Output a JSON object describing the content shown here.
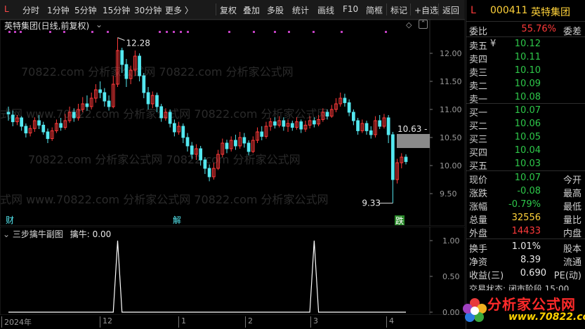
{
  "toolbar": {
    "items": [
      "分时",
      "1分钟",
      "5分钟",
      "15分钟",
      "30分钟",
      "更多 〉",
      "复权",
      "叠加",
      "多股",
      "统计",
      "画线",
      "F10",
      "简框",
      "标记",
      "+自选",
      "返回"
    ]
  },
  "main_chart": {
    "title": "英特集团(日线,前复权)",
    "high_label": "12.28",
    "low_label": "9.33",
    "current_label": "10.63",
    "y_ticks": [
      "12.00",
      "11.50",
      "11.00",
      "10.50",
      "10.00",
      "9.50"
    ],
    "marker_cai": "财",
    "marker_jie": "解",
    "marker_die": "跌",
    "watermarks": [
      "70822.com 分析家公式网",
      "式网 www.70822.com 分析家公式网"
    ]
  },
  "sub_chart": {
    "title": "三步擒牛副图",
    "indicator": "擒牛: 0.00",
    "y_ticks": [
      "1.00",
      "0.50",
      "0.00"
    ]
  },
  "xaxis": {
    "labels": [
      "2024年",
      "12",
      "1",
      "2",
      "3",
      "4"
    ]
  },
  "quote_panel": {
    "L": "L",
    "code": "000411",
    "name": "英特集团",
    "weibi_label": "委比",
    "weibi_value": "55.76%",
    "weicha_label": "委差",
    "asks": [
      {
        "label": "卖五",
        "flag": "¥",
        "price": "10.12"
      },
      {
        "label": "卖四",
        "flag": "",
        "price": "10.11"
      },
      {
        "label": "卖三",
        "flag": "",
        "price": "10.10"
      },
      {
        "label": "卖二",
        "flag": "",
        "price": "10.09"
      },
      {
        "label": "卖一",
        "flag": "",
        "price": "10.08"
      }
    ],
    "bids": [
      {
        "label": "买一",
        "price": "10.07"
      },
      {
        "label": "买二",
        "price": "10.06"
      },
      {
        "label": "买三",
        "price": "10.05"
      },
      {
        "label": "买四",
        "price": "10.04"
      },
      {
        "label": "买五",
        "price": "10.03"
      }
    ],
    "stats": [
      {
        "label": "现价",
        "value": "10.07",
        "color": "green",
        "r": "今开"
      },
      {
        "label": "涨跌",
        "value": "-0.08",
        "color": "green",
        "r": "最高"
      },
      {
        "label": "涨幅",
        "value": "-0.79%",
        "color": "green",
        "r": "最低"
      },
      {
        "label": "总量",
        "value": "32556",
        "color": "yellow",
        "r": "量比"
      },
      {
        "label": "外盘",
        "value": "14433",
        "color": "red",
        "r": "内盘"
      }
    ],
    "stats2": [
      {
        "label": "换手",
        "value": "1.01%",
        "r": "股本"
      },
      {
        "label": "净资",
        "value": "8.39",
        "r": "流通"
      },
      {
        "label": "收益(三)",
        "value": "0.690",
        "r": "PE(动)"
      }
    ],
    "trade_status": "交易状态: 闭市阶段 15:00",
    "logo_text": "分析家公式网",
    "logo_url": "www.70822.com"
  },
  "chart_data": {
    "type": "candlestick",
    "title": "英特集团(日线,前复权)",
    "ylim": [
      9.2,
      12.4
    ],
    "candles": [
      [
        10.95,
        10.92,
        11.05,
        10.8
      ],
      [
        10.9,
        10.78,
        10.98,
        10.7
      ],
      [
        10.78,
        10.85,
        10.9,
        10.72
      ],
      [
        10.85,
        10.7,
        10.88,
        10.62
      ],
      [
        10.7,
        10.58,
        10.75,
        10.5
      ],
      [
        10.58,
        10.66,
        10.72,
        10.52
      ],
      [
        10.66,
        10.8,
        10.86,
        10.6
      ],
      [
        10.8,
        10.72,
        10.9,
        10.65
      ],
      [
        10.72,
        10.6,
        10.78,
        10.55
      ],
      [
        10.6,
        10.48,
        10.66,
        10.4
      ],
      [
        10.48,
        10.62,
        10.68,
        10.44
      ],
      [
        10.62,
        10.75,
        10.82,
        10.58
      ],
      [
        10.75,
        10.68,
        10.85,
        10.62
      ],
      [
        10.68,
        10.8,
        10.92,
        10.64
      ],
      [
        10.8,
        10.95,
        11.05,
        10.76
      ],
      [
        10.95,
        10.85,
        11.02,
        10.78
      ],
      [
        10.85,
        11.0,
        11.1,
        10.8
      ],
      [
        11.0,
        11.1,
        11.22,
        10.95
      ],
      [
        11.1,
        11.05,
        11.25,
        10.98
      ],
      [
        11.05,
        11.2,
        11.3,
        11.0
      ],
      [
        11.2,
        11.35,
        11.45,
        11.12
      ],
      [
        11.35,
        11.3,
        11.5,
        11.2
      ],
      [
        11.3,
        11.15,
        11.38,
        11.05
      ],
      [
        11.15,
        11.05,
        11.25,
        10.98
      ],
      [
        11.05,
        11.45,
        11.6,
        11.02
      ],
      [
        11.45,
        12.05,
        12.28,
        11.4
      ],
      [
        12.05,
        11.8,
        12.1,
        11.65
      ],
      [
        11.8,
        11.55,
        11.9,
        11.4
      ],
      [
        11.55,
        11.7,
        11.78,
        11.45
      ],
      [
        11.7,
        11.95,
        12.05,
        11.6
      ],
      [
        11.95,
        11.6,
        12.0,
        11.5
      ],
      [
        11.6,
        11.3,
        11.65,
        11.2
      ],
      [
        11.3,
        11.1,
        11.4,
        11.0
      ],
      [
        11.1,
        11.25,
        11.32,
        11.02
      ],
      [
        11.25,
        11.05,
        11.3,
        10.95
      ],
      [
        11.05,
        10.85,
        11.1,
        10.78
      ],
      [
        10.85,
        10.95,
        11.02,
        10.8
      ],
      [
        10.95,
        10.75,
        11.0,
        10.68
      ],
      [
        10.75,
        10.6,
        10.82,
        10.52
      ],
      [
        10.6,
        10.7,
        10.78,
        10.55
      ],
      [
        10.7,
        10.5,
        10.75,
        10.4
      ],
      [
        10.5,
        10.35,
        10.58,
        10.25
      ],
      [
        10.35,
        10.2,
        10.42,
        10.12
      ],
      [
        10.2,
        10.3,
        10.38,
        10.1
      ],
      [
        10.3,
        10.1,
        10.35,
        10.0
      ],
      [
        10.1,
        9.95,
        10.15,
        9.85
      ],
      [
        9.95,
        9.8,
        10.02,
        9.72
      ],
      [
        9.8,
        9.95,
        10.05,
        9.75
      ],
      [
        9.95,
        10.2,
        10.28,
        9.92
      ],
      [
        10.2,
        10.4,
        10.48,
        10.15
      ],
      [
        10.4,
        10.3,
        10.46,
        10.22
      ],
      [
        10.3,
        10.45,
        10.52,
        10.25
      ],
      [
        10.45,
        10.35,
        10.55,
        10.28
      ],
      [
        10.35,
        10.5,
        10.6,
        10.3
      ],
      [
        10.5,
        10.4,
        10.58,
        10.32
      ],
      [
        10.4,
        10.25,
        10.45,
        10.18
      ],
      [
        10.25,
        10.45,
        10.52,
        10.22
      ],
      [
        10.45,
        10.6,
        10.68,
        10.4
      ],
      [
        10.6,
        10.52,
        10.7,
        10.45
      ],
      [
        10.52,
        10.7,
        10.78,
        10.48
      ],
      [
        10.7,
        10.78,
        10.85,
        10.62
      ],
      [
        10.78,
        10.72,
        10.86,
        10.66
      ],
      [
        10.72,
        10.8,
        10.88,
        10.68
      ],
      [
        10.8,
        10.7,
        10.86,
        10.62
      ],
      [
        10.7,
        10.75,
        10.82,
        10.6
      ],
      [
        10.75,
        10.68,
        10.8,
        10.62
      ],
      [
        10.68,
        10.78,
        10.86,
        10.64
      ],
      [
        10.78,
        10.65,
        10.82,
        10.58
      ],
      [
        10.65,
        10.72,
        10.8,
        10.6
      ],
      [
        10.72,
        10.8,
        10.88,
        10.66
      ],
      [
        10.8,
        10.74,
        10.86,
        10.68
      ],
      [
        10.74,
        10.82,
        10.9,
        10.7
      ],
      [
        10.82,
        10.95,
        11.02,
        10.78
      ],
      [
        10.95,
        10.88,
        11.0,
        10.82
      ],
      [
        10.88,
        11.0,
        11.08,
        10.85
      ],
      [
        11.0,
        11.1,
        11.2,
        10.95
      ],
      [
        11.1,
        11.2,
        11.3,
        11.05
      ],
      [
        11.2,
        11.12,
        11.28,
        11.05
      ],
      [
        11.12,
        10.95,
        11.18,
        10.88
      ],
      [
        10.95,
        10.8,
        11.0,
        10.72
      ],
      [
        10.8,
        10.62,
        10.85,
        10.55
      ],
      [
        10.62,
        10.75,
        10.82,
        10.58
      ],
      [
        10.75,
        10.62,
        10.8,
        10.55
      ],
      [
        10.62,
        10.55,
        10.7,
        10.48
      ],
      [
        10.55,
        10.8,
        10.88,
        10.5
      ],
      [
        10.8,
        10.7,
        10.9,
        10.65
      ],
      [
        10.7,
        10.85,
        10.92,
        10.66
      ],
      [
        10.85,
        10.55,
        10.9,
        10.4
      ],
      [
        10.55,
        9.75,
        10.6,
        9.33
      ],
      [
        9.75,
        10.05,
        10.12,
        9.68
      ],
      [
        10.05,
        10.15,
        10.22,
        9.95
      ],
      [
        10.15,
        10.07,
        10.2,
        10.02
      ]
    ],
    "sub_series": {
      "name": "擒牛",
      "spikes_at": [
        25,
        70
      ],
      "values_range": [
        0,
        1
      ]
    }
  }
}
